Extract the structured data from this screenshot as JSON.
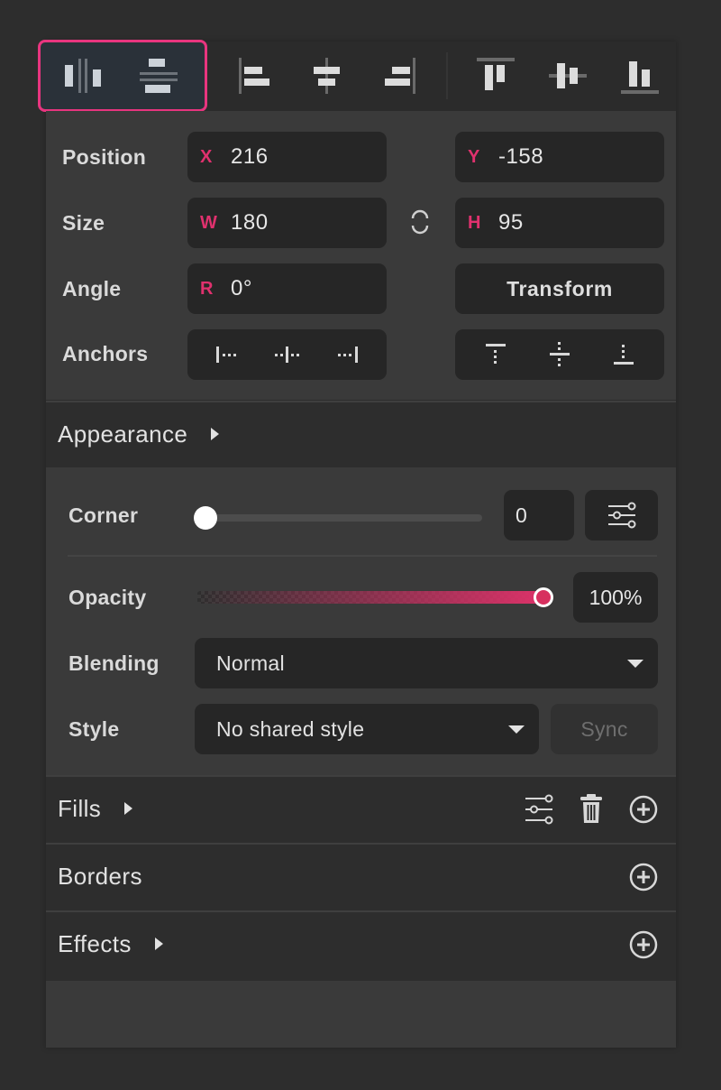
{
  "colors": {
    "accent": "#e0316e",
    "highlight_border": "#e8357f",
    "panel_bg": "#3a3a3a",
    "field_bg": "#262626",
    "header_bg": "#2d2d2d"
  },
  "toolbar": {
    "distribute": [
      {
        "icon": "distribute-horizontal-icon",
        "selected_group": true
      },
      {
        "icon": "distribute-vertical-icon",
        "selected_group": true
      }
    ],
    "align_horizontal": [
      {
        "icon": "align-left-icon"
      },
      {
        "icon": "align-center-horizontal-icon"
      },
      {
        "icon": "align-right-icon"
      }
    ],
    "align_vertical": [
      {
        "icon": "align-top-icon"
      },
      {
        "icon": "align-middle-vertical-icon"
      },
      {
        "icon": "align-bottom-icon"
      }
    ]
  },
  "transform": {
    "position": {
      "label": "Position",
      "x_prefix": "X",
      "x": "216",
      "y_prefix": "Y",
      "y": "-158"
    },
    "size": {
      "label": "Size",
      "w_prefix": "W",
      "w": "180",
      "h_prefix": "H",
      "h": "95",
      "lock_icon": "link-proportions-icon"
    },
    "angle": {
      "label": "Angle",
      "r_prefix": "R",
      "r": "0°",
      "transform_button": "Transform"
    },
    "anchors": {
      "label": "Anchors",
      "horizontal": [
        "anchor-left-icon",
        "anchor-center-horizontal-icon",
        "anchor-right-icon"
      ],
      "vertical": [
        "anchor-top-icon",
        "anchor-middle-vertical-icon",
        "anchor-bottom-icon"
      ]
    }
  },
  "appearance": {
    "title": "Appearance",
    "corner": {
      "label": "Corner",
      "value": "0",
      "slider_fraction": 0
    },
    "opacity": {
      "label": "Opacity",
      "value": "100%",
      "slider_fraction": 1.0
    },
    "blending": {
      "label": "Blending",
      "selected": "Normal"
    },
    "style": {
      "label": "Style",
      "selected": "No shared style",
      "sync_label": "Sync",
      "sync_enabled": false
    }
  },
  "sections": {
    "fills": {
      "title": "Fills",
      "icons": [
        "settings-sliders-icon",
        "trash-icon",
        "add-circle-icon"
      ]
    },
    "borders": {
      "title": "Borders",
      "icons": [
        "add-circle-icon"
      ]
    },
    "effects": {
      "title": "Effects",
      "icons": [
        "add-circle-icon"
      ]
    }
  }
}
